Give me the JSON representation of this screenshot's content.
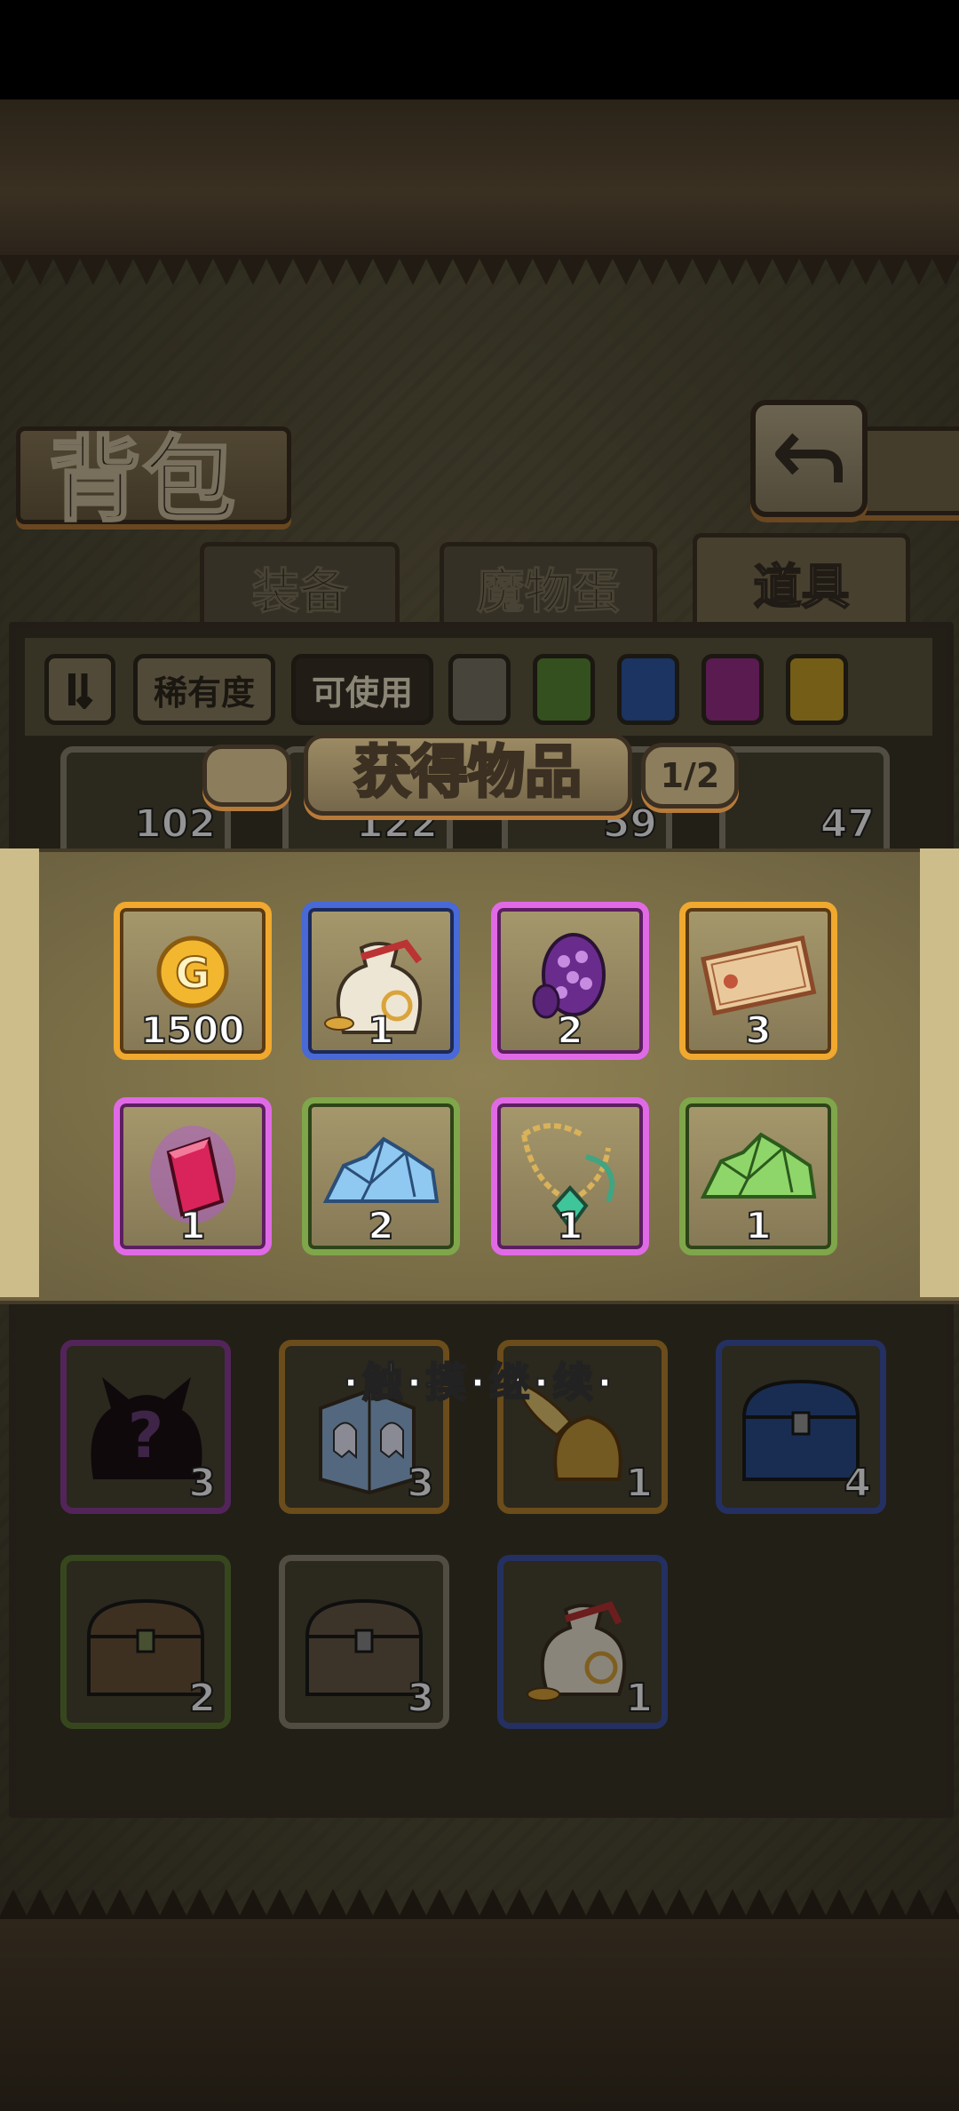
{
  "title": "背包",
  "tabs": [
    {
      "label": "装备",
      "active": false
    },
    {
      "label": "魔物蛋",
      "active": false
    },
    {
      "label": "道具",
      "active": true
    }
  ],
  "filters": {
    "sort_icon": "sort-toggle-icon",
    "rarity_label": "稀有度",
    "usable_label": "可使用",
    "rarity_swatches": [
      "#7b7766",
      "#5a8a36",
      "#2f5aa8",
      "#9a2f8a",
      "#c9a126"
    ]
  },
  "background_row": {
    "counts": [
      "102",
      "122",
      "59",
      "47"
    ]
  },
  "reward_popup": {
    "title": "获得物品",
    "page": "1/2",
    "items": [
      {
        "icon": "gold-coin-icon",
        "quantity": "1500",
        "rarity": "gold"
      },
      {
        "icon": "coin-bag-icon",
        "quantity": "1",
        "rarity": "blue"
      },
      {
        "icon": "purple-egg-icon",
        "quantity": "2",
        "rarity": "purple"
      },
      {
        "icon": "ticket-icon",
        "quantity": "3",
        "rarity": "gold"
      },
      {
        "icon": "red-crystal-icon",
        "quantity": "1",
        "rarity": "purple"
      },
      {
        "icon": "blue-ore-icon",
        "quantity": "2",
        "rarity": "green"
      },
      {
        "icon": "amulet-icon",
        "quantity": "1",
        "rarity": "purple"
      },
      {
        "icon": "green-ore-icon",
        "quantity": "1",
        "rarity": "green"
      }
    ]
  },
  "touch_hint": "·触·摸·继·续·",
  "inventory": [
    {
      "icon": "mystery-silhouette-icon",
      "quantity": "3"
    },
    {
      "icon": "ghost-box-icon",
      "quantity": "3"
    },
    {
      "icon": "winged-helmet-icon",
      "quantity": "1"
    },
    {
      "icon": "blue-chest-icon",
      "quantity": "4"
    },
    {
      "icon": "green-chest-icon",
      "quantity": "2"
    },
    {
      "icon": "gray-chest-icon",
      "quantity": "3"
    },
    {
      "icon": "coin-bag-icon",
      "quantity": "1"
    }
  ]
}
